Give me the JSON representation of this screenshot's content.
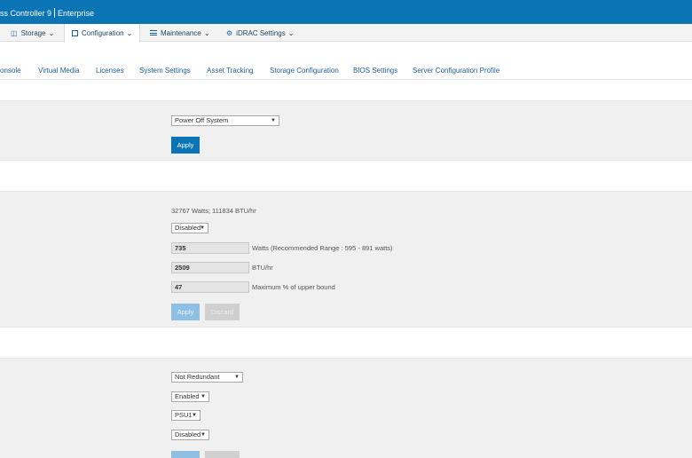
{
  "header": {
    "title_left": "ss Controller 9",
    "title_right": "Enterprise"
  },
  "menu": [
    {
      "label": "Storage",
      "icon": "storage-icon"
    },
    {
      "label": "Configuration",
      "icon": "configuration-icon"
    },
    {
      "label": "Maintenance",
      "icon": "maintenance-icon"
    },
    {
      "label": "iDRAC Settings",
      "icon": "idrac-settings-icon"
    }
  ],
  "subtabs": [
    "onsole",
    "Virtual Media",
    "Licenses",
    "System Settings",
    "Asset Tracking",
    "Storage Configuration",
    "BIOS Settings",
    "Server Configuration Profile"
  ],
  "section1": {
    "select_value": "Power Off System",
    "apply_label": "Apply"
  },
  "section2": {
    "capacity_text": "32767 Watts; 111834 BTU/hr",
    "enable_select": "Disabled",
    "watts_value": "735",
    "watts_label": "Watts (Recommended Range : 595 - 891 watts)",
    "btu_value": "2509",
    "btu_label": "BTU/hr",
    "percent_value": "47",
    "percent_label": "Maximum % of upper bound",
    "apply_label": "Apply",
    "discard_label": "Discard"
  },
  "section3": {
    "redundancy_select": "Not Redundant",
    "enabled_select": "Enabled",
    "psu_select": "PSU1",
    "disabled_select": "Disabled"
  },
  "colors": {
    "header_blue": "#0a74b4",
    "button_blue": "#0a74b4",
    "button_disabled": "#8fc0e4"
  }
}
